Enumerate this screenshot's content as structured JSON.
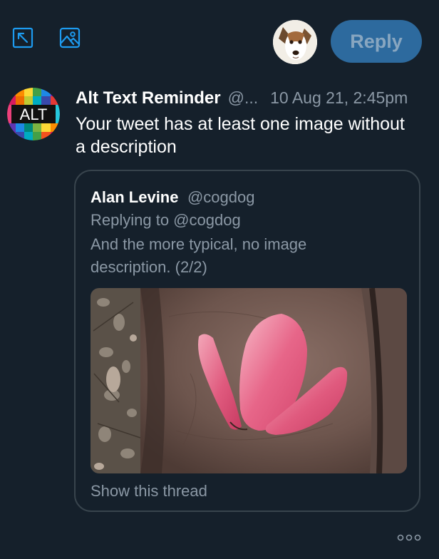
{
  "toolbar": {
    "expand_icon": "expand-arrow-icon",
    "image_icon": "image-icon",
    "reply_label": "Reply",
    "avatar_icon": "dog-avatar"
  },
  "tweet": {
    "avatar_text": "ALT",
    "author_name": "Alt Text Reminder",
    "author_handle": "@...",
    "timestamp": "10 Aug 21, 2:45pm",
    "text": "Your tweet has at least one image without a description"
  },
  "quoted": {
    "author_name": "Alan Levine",
    "author_handle": "@cogdog",
    "replying_to": "Replying to @cogdog",
    "text": "And the more typical, no image description. (2/2)",
    "show_thread_label": "Show this thread"
  },
  "footer": {
    "more_icon": "more-options-icon"
  },
  "colors": {
    "background": "#15202b",
    "accent": "#1d9bf0",
    "reply_button": "#2d6a9e",
    "muted_text": "#8b98a5",
    "border": "#38444d"
  }
}
